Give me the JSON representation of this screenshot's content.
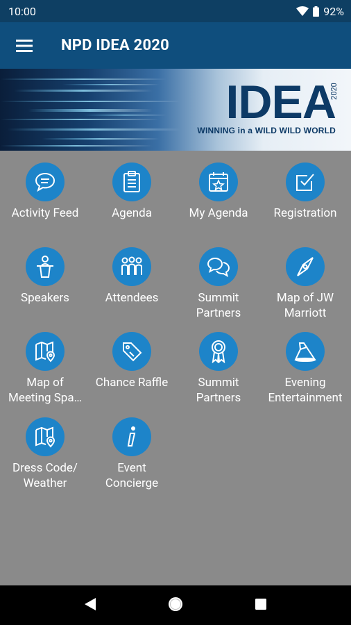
{
  "status": {
    "time": "10:00",
    "battery": "92%"
  },
  "app_bar": {
    "title": "NPD IDEA 2020"
  },
  "banner": {
    "word": "IDEA",
    "year": "2020",
    "tagline": "WINNING in a WILD WILD WORLD"
  },
  "tiles": [
    {
      "label": "Activity Feed",
      "icon": "chat-bubble-icon"
    },
    {
      "label": "Agenda",
      "icon": "clipboard-icon"
    },
    {
      "label": "My Agenda",
      "icon": "calendar-star-icon"
    },
    {
      "label": "Registration",
      "icon": "checkbox-icon"
    },
    {
      "label": "Speakers",
      "icon": "podium-speaker-icon"
    },
    {
      "label": "Attendees",
      "icon": "people-icon"
    },
    {
      "label": "Summit\nPartners",
      "icon": "chat-bubbles-icon"
    },
    {
      "label": "Map of JW\nMarriott",
      "icon": "compass-icon"
    },
    {
      "label": "Map of\nMeeting Spa…",
      "icon": "map-pin-icon"
    },
    {
      "label": "Chance Raffle",
      "icon": "ticket-tag-icon"
    },
    {
      "label": "Summit\nPartners",
      "icon": "award-ribbon-icon"
    },
    {
      "label": "Evening\nEntertainment",
      "icon": "spotlight-icon"
    },
    {
      "label": "Dress Code/\nWeather",
      "icon": "map-pin-icon"
    },
    {
      "label": "Event\nConcierge",
      "icon": "info-icon"
    }
  ]
}
